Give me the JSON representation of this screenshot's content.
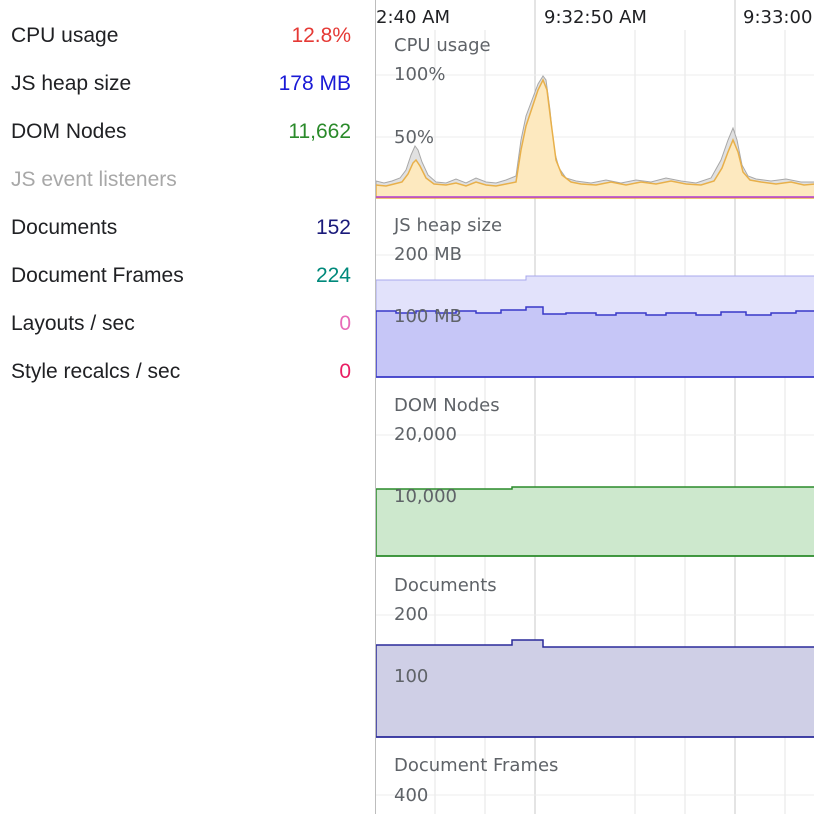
{
  "metrics": [
    {
      "label": "CPU usage",
      "value": "12.8%",
      "color": "#e53935",
      "enabled": true
    },
    {
      "label": "JS heap size",
      "value": "178 MB",
      "color": "#1a1ad6",
      "enabled": true
    },
    {
      "label": "DOM Nodes",
      "value": "11,662",
      "color": "#2a8a2a",
      "enabled": true
    },
    {
      "label": "JS event listeners",
      "value": "",
      "color": "#a8a8a8",
      "enabled": false
    },
    {
      "label": "Documents",
      "value": "152",
      "color": "#1a1a7a",
      "enabled": true
    },
    {
      "label": "Document Frames",
      "value": "224",
      "color": "#00897b",
      "enabled": true
    },
    {
      "label": "Layouts / sec",
      "value": "0",
      "color": "#e86ab8",
      "enabled": true
    },
    {
      "label": "Style recalcs / sec",
      "value": "0",
      "color": "#e91e63",
      "enabled": true
    }
  ],
  "timeline": {
    "labels": [
      "2:40 AM",
      "9:32:50 AM",
      "9:33:00"
    ]
  },
  "charts": {
    "cpu": {
      "title": "CPU usage",
      "ticks": [
        "100%",
        "50%"
      ]
    },
    "heap": {
      "title": "JS heap size",
      "ticks": [
        "200 MB",
        "100 MB"
      ]
    },
    "dom": {
      "title": "DOM Nodes",
      "ticks": [
        "20,000",
        "10,000"
      ]
    },
    "documents": {
      "title": "Documents",
      "ticks": [
        "200",
        "100"
      ]
    },
    "frames": {
      "title": "Document Frames",
      "ticks": [
        "400"
      ]
    }
  },
  "colors": {
    "cpu_fill": "#fde9bf",
    "cpu_line": "#e8b04a",
    "cpu_gray": "#d9d9d9",
    "cpu_base": "#b23bd3",
    "heap_fill_light": "#e2e2fb",
    "heap_fill": "#c6c6f7",
    "heap_line": "#3838c8",
    "dom_fill": "#cde8cd",
    "dom_line": "#2a8a2a",
    "docs_fill": "#cfcfe6",
    "docs_line": "#2a2a9a"
  }
}
